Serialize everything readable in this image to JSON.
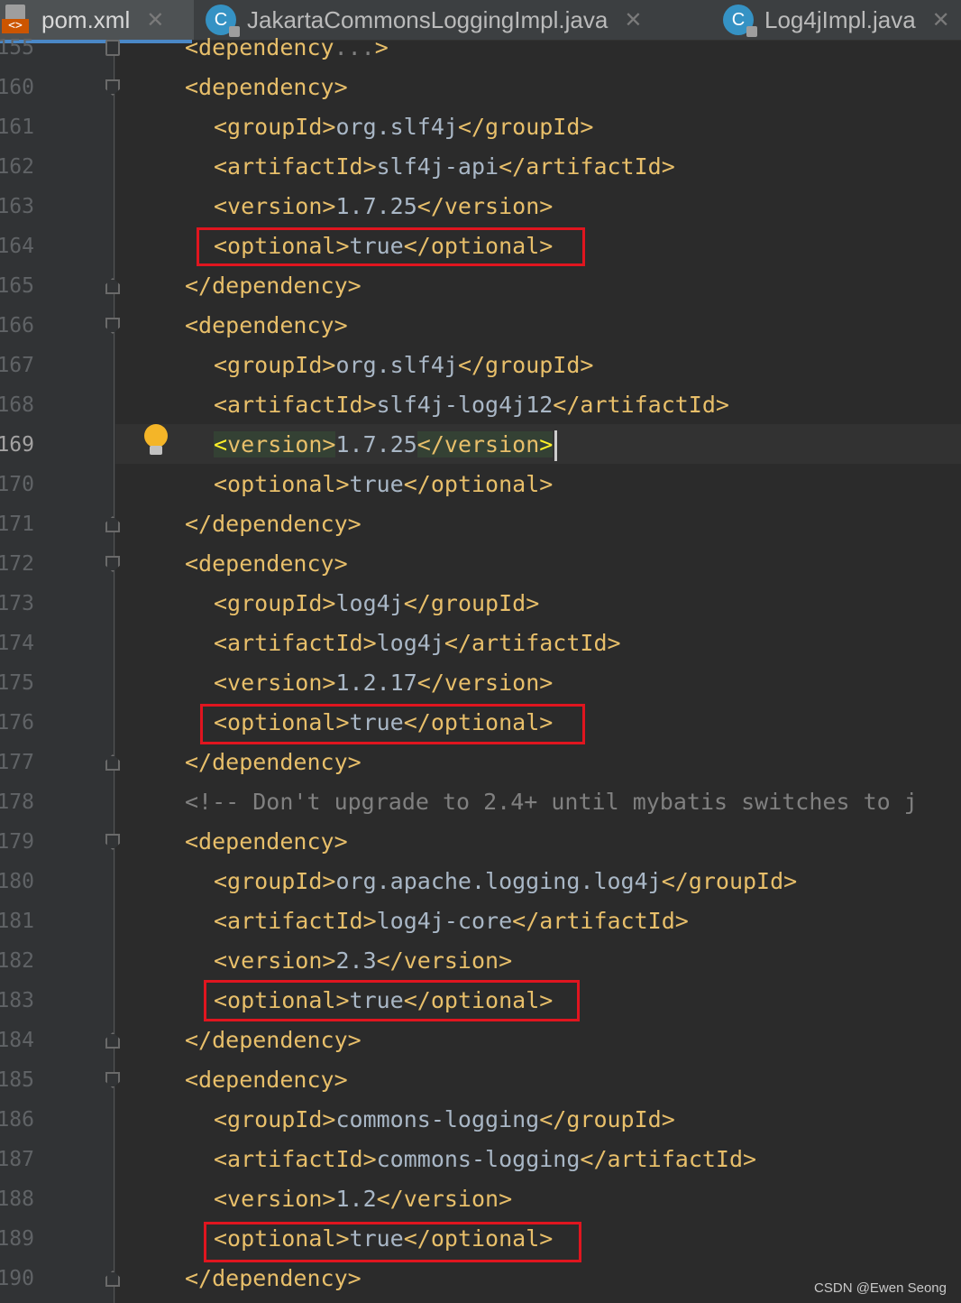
{
  "tabs": [
    {
      "label": "pom.xml",
      "icon": "xml-file-icon",
      "active": true
    },
    {
      "label": "JakartaCommonsLoggingImpl.java",
      "icon": "java-class-icon",
      "active": false
    },
    {
      "label": "Log4jImpl.java",
      "icon": "java-class-icon",
      "active": false
    }
  ],
  "tab_close_glyph": "✕",
  "editor": {
    "current_line": 169,
    "lines": [
      {
        "n": "155",
        "parts": [
          [
            "tag",
            "<dependency"
          ],
          [
            "cmt",
            "..."
          ],
          [
            "tag",
            ">"
          ]
        ]
      },
      {
        "n": "160",
        "parts": [
          [
            "tag",
            "<dependency>"
          ]
        ]
      },
      {
        "n": "161",
        "parts": [
          [
            "tag",
            "<groupId>"
          ],
          [
            "txt",
            "org.slf4j"
          ],
          [
            "tag",
            "</groupId>"
          ]
        ]
      },
      {
        "n": "162",
        "parts": [
          [
            "tag",
            "<artifactId>"
          ],
          [
            "txt",
            "slf4j-api"
          ],
          [
            "tag",
            "</artifactId>"
          ]
        ]
      },
      {
        "n": "163",
        "parts": [
          [
            "tag",
            "<version>"
          ],
          [
            "txt",
            "1.7.25"
          ],
          [
            "tag",
            "</version>"
          ]
        ]
      },
      {
        "n": "164",
        "parts": [
          [
            "tag",
            "<optional>"
          ],
          [
            "txt",
            "true"
          ],
          [
            "tag",
            "</optional>"
          ]
        ]
      },
      {
        "n": "165",
        "parts": [
          [
            "tag",
            "</dependency>"
          ]
        ]
      },
      {
        "n": "166",
        "parts": [
          [
            "tag",
            "<dependency>"
          ]
        ]
      },
      {
        "n": "167",
        "parts": [
          [
            "tag",
            "<groupId>"
          ],
          [
            "txt",
            "org.slf4j"
          ],
          [
            "tag",
            "</groupId>"
          ]
        ]
      },
      {
        "n": "168",
        "parts": [
          [
            "tag",
            "<artifactId>"
          ],
          [
            "txt",
            "slf4j-log4j12"
          ],
          [
            "tag",
            "</artifactId>"
          ]
        ]
      },
      {
        "n": "169",
        "parts": [
          [
            "hl",
            "<version>"
          ],
          [
            "txt",
            "1.7.25"
          ],
          [
            "hl",
            "</version>"
          ]
        ]
      },
      {
        "n": "170",
        "parts": [
          [
            "tag",
            "<optional>"
          ],
          [
            "txt",
            "true"
          ],
          [
            "tag",
            "</optional>"
          ]
        ]
      },
      {
        "n": "171",
        "parts": [
          [
            "tag",
            "</dependency>"
          ]
        ]
      },
      {
        "n": "172",
        "parts": [
          [
            "tag",
            "<dependency>"
          ]
        ]
      },
      {
        "n": "173",
        "parts": [
          [
            "tag",
            "<groupId>"
          ],
          [
            "txt",
            "log4j"
          ],
          [
            "tag",
            "</groupId>"
          ]
        ]
      },
      {
        "n": "174",
        "parts": [
          [
            "tag",
            "<artifactId>"
          ],
          [
            "txt",
            "log4j"
          ],
          [
            "tag",
            "</artifactId>"
          ]
        ]
      },
      {
        "n": "175",
        "parts": [
          [
            "tag",
            "<version>"
          ],
          [
            "txt",
            "1.2.17"
          ],
          [
            "tag",
            "</version>"
          ]
        ]
      },
      {
        "n": "176",
        "parts": [
          [
            "tag",
            "<optional>"
          ],
          [
            "txt",
            "true"
          ],
          [
            "tag",
            "</optional>"
          ]
        ]
      },
      {
        "n": "177",
        "parts": [
          [
            "tag",
            "</dependency>"
          ]
        ]
      },
      {
        "n": "178",
        "parts": [
          [
            "cmt",
            "<!-- Don't upgrade to 2.4+ until mybatis switches to j"
          ]
        ]
      },
      {
        "n": "179",
        "parts": [
          [
            "tag",
            "<dependency>"
          ]
        ]
      },
      {
        "n": "180",
        "parts": [
          [
            "tag",
            "<groupId>"
          ],
          [
            "txt",
            "org.apache.logging.log4j"
          ],
          [
            "tag",
            "</groupId>"
          ]
        ]
      },
      {
        "n": "181",
        "parts": [
          [
            "tag",
            "<artifactId>"
          ],
          [
            "txt",
            "log4j-core"
          ],
          [
            "tag",
            "</artifactId>"
          ]
        ]
      },
      {
        "n": "182",
        "parts": [
          [
            "tag",
            "<version>"
          ],
          [
            "txt",
            "2.3"
          ],
          [
            "tag",
            "</version>"
          ]
        ]
      },
      {
        "n": "183",
        "parts": [
          [
            "tag",
            "<optional>"
          ],
          [
            "txt",
            "true"
          ],
          [
            "tag",
            "</optional>"
          ]
        ]
      },
      {
        "n": "184",
        "parts": [
          [
            "tag",
            "</dependency>"
          ]
        ]
      },
      {
        "n": "185",
        "parts": [
          [
            "tag",
            "<dependency>"
          ]
        ]
      },
      {
        "n": "186",
        "parts": [
          [
            "tag",
            "<groupId>"
          ],
          [
            "txt",
            "commons-logging"
          ],
          [
            "tag",
            "</groupId>"
          ]
        ]
      },
      {
        "n": "187",
        "parts": [
          [
            "tag",
            "<artifactId>"
          ],
          [
            "txt",
            "commons-logging"
          ],
          [
            "tag",
            "</artifactId>"
          ]
        ]
      },
      {
        "n": "188",
        "parts": [
          [
            "tag",
            "<version>"
          ],
          [
            "txt",
            "1.2"
          ],
          [
            "tag",
            "</version>"
          ]
        ]
      },
      {
        "n": "189",
        "parts": [
          [
            "tag",
            "<optional>"
          ],
          [
            "txt",
            "true"
          ],
          [
            "tag",
            "</optional>"
          ]
        ]
      },
      {
        "n": "190",
        "parts": [
          [
            "tag",
            "</dependency>"
          ]
        ]
      }
    ]
  },
  "watermark": "CSDN @Ewen Seong",
  "colors": {
    "tag": "#e8bf6a",
    "text": "#a9b7c6",
    "comment": "#808080",
    "highlight_box": "#e0151f",
    "background": "#2b2b2b"
  }
}
